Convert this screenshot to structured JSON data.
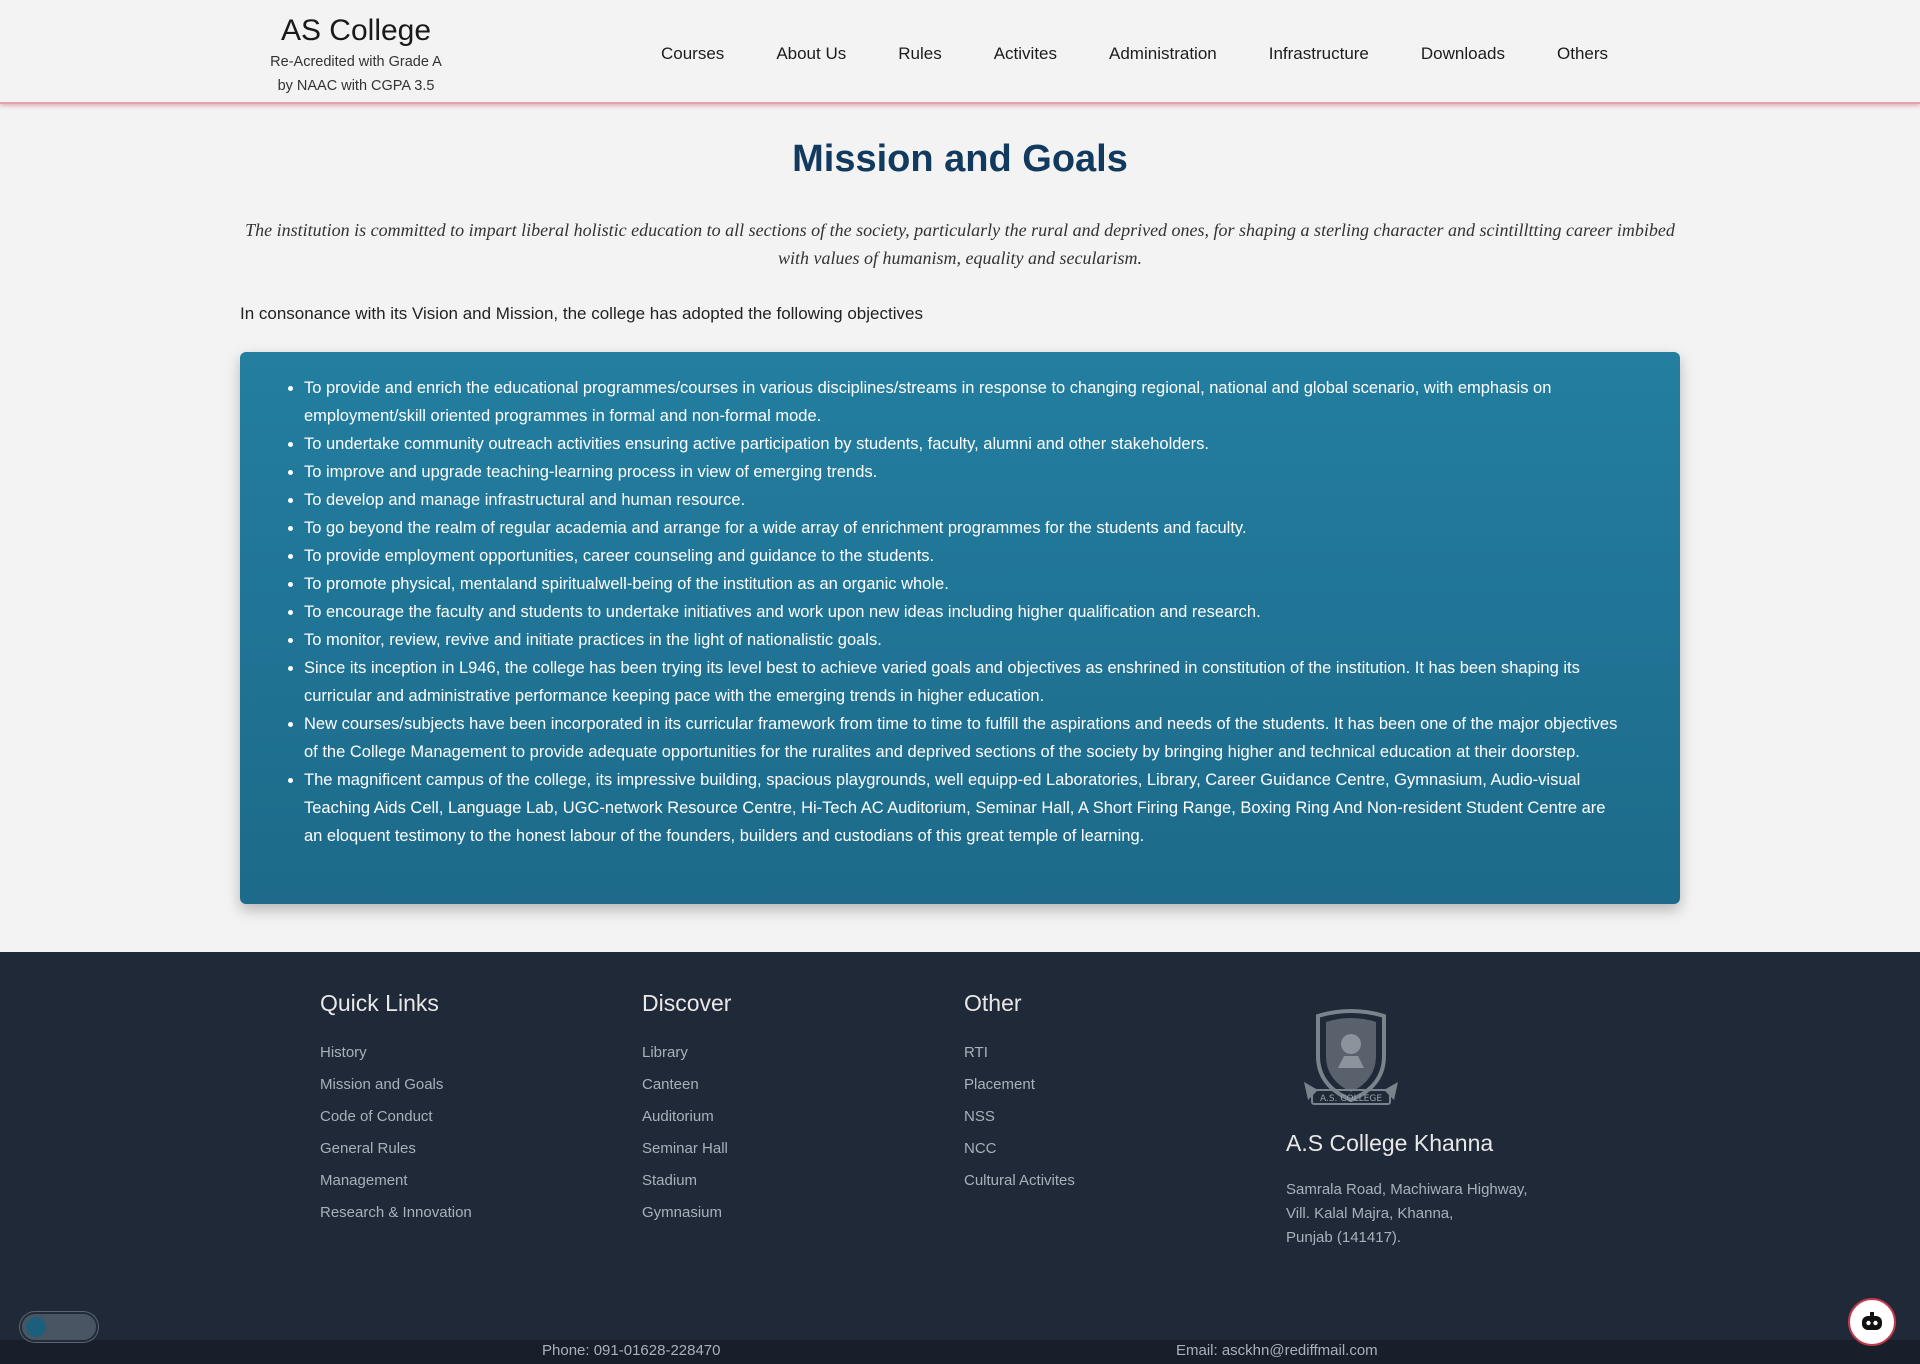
{
  "header": {
    "title": "AS College",
    "subtitle_line1": "Re-Acredited with Grade A",
    "subtitle_line2": "by NAAC with CGPA 3.5",
    "nav": [
      "Courses",
      "About Us",
      "Rules",
      "Activites",
      "Administration",
      "Infrastructure",
      "Downloads",
      "Others"
    ]
  },
  "main": {
    "title": "Mission and Goals",
    "mission": "The institution is committed to impart liberal holistic education to all sections of the society, particularly the rural and deprived ones, for shaping a sterling character and scintilltting career imbibed with values of humanism, equality and secularism.",
    "intro": "In consonance with its Vision and Mission, the college has adopted the following objectives",
    "objectives": [
      "To provide and enrich the educational programmes/courses in various disciplines/streams in response to changing regional, national and global scenario, with emphasis on employment/skill oriented programmes in formal and non-formal mode.",
      "To undertake community outreach activities ensuring active participation by students, faculty, alumni and other stakeholders.",
      "To improve and upgrade teaching-learning process in view of emerging trends.",
      "To develop and manage infrastructural and human resource.",
      "To go beyond the realm of regular academia and arrange for a wide array of enrichment programmes for the students and faculty.",
      "To provide employment opportunities, career counseling and guidance to the students.",
      "To promote physical, mentaland spiritualwell-being of the institution as an organic whole.",
      "To encourage the faculty and students to undertake initiatives and work upon new ideas including higher qualification and research.",
      "To monitor, review, revive and initiate practices in the light of nationalistic goals.",
      "Since its inception in L946, the college has been trying its level best to achieve varied goals and objectives as enshrined in constitution of the institution. It has been shaping its curricular and administrative performance keeping pace with the emerging trends in higher education.",
      "New courses/subjects have been incorporated in its curricular framework from time to time to fulfill the aspirations and needs of the students. It has been one of the major objectives of the College Management to provide adequate opportunities for the ruralites and deprived sections of the society by bringing higher and technical education at their doorstep.",
      "The magnificent campus of the college, its impressive building, spacious playgrounds, well equipp-ed Laboratories, Library, Career Guidance Centre, Gymnasium, Audio-visual Teaching Aids Cell, Language Lab, UGC-network Resource Centre, Hi-Tech AC Auditorium, Seminar Hall, A Short Firing Range, Boxing Ring And Non-resident Student Centre are an eloquent testimony to the honest labour of the founders, builders and custodians of this great temple of learning."
    ]
  },
  "footer": {
    "quick_links": {
      "heading": "Quick Links",
      "items": [
        "History",
        "Mission and Goals",
        "Code of Conduct",
        "General Rules",
        "Management",
        "Research & Innovation"
      ]
    },
    "discover": {
      "heading": "Discover",
      "items": [
        "Library",
        "Canteen",
        "Auditorium",
        "Seminar Hall",
        "Stadium",
        "Gymnasium"
      ]
    },
    "other": {
      "heading": "Other",
      "items": [
        "RTI",
        "Placement",
        "NSS",
        "NCC",
        "Cultural Activites"
      ]
    },
    "college_name": "A.S College Khanna",
    "address_line1": "Samrala Road, Machiwara Highway,",
    "address_line2": "Vill. Kalal Majra, Khanna,",
    "address_line3": "Punjab (141417).",
    "crest_text": "A.S. COLLEGE",
    "phone": "Phone: 091-01628-228470",
    "email": "Email: asckhn@rediffmail.com"
  },
  "colors": {
    "accent": "#123a5e",
    "objectives_bg": "#1f7396",
    "footer_bg": "#1f2937",
    "header_border": "#e4a4ae"
  },
  "icons": {
    "crest": "college-crest-icon",
    "chatbot": "chatbot-icon",
    "theme_toggle": "theme-toggle"
  }
}
